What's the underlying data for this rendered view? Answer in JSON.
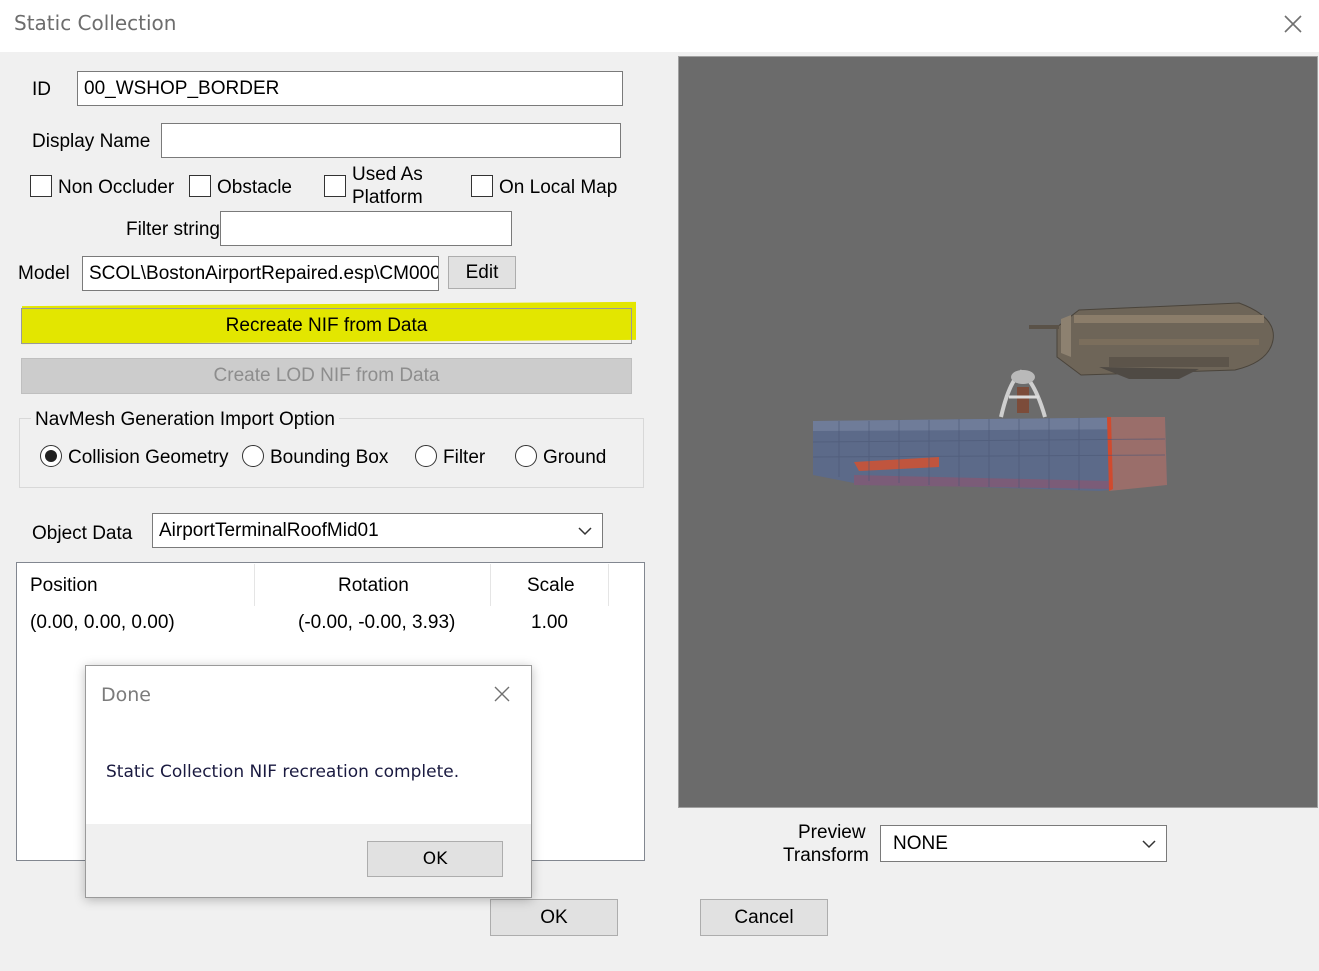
{
  "window": {
    "title": "Static Collection"
  },
  "form": {
    "id_label": "ID",
    "id_value": "00_WSHOP_BORDER",
    "display_name_label": "Display Name",
    "display_name_value": "",
    "checkboxes": {
      "non_occluder": "Non Occluder",
      "obstacle": "Obstacle",
      "used_as_platform_line1": "Used As",
      "used_as_platform_line2": "Platform",
      "on_local_map": "On Local Map"
    },
    "filter_label": "Filter string",
    "filter_value": "",
    "model_label": "Model",
    "model_value": "SCOL\\BostonAirportRepaired.esp\\CM000",
    "edit_button": "Edit",
    "recreate_button": "Recreate NIF from Data",
    "create_lod_button": "Create LOD NIF from Data",
    "navmesh": {
      "group_label": "NavMesh Generation Import Option",
      "options": [
        "Collision Geometry",
        "Bounding Box",
        "Filter",
        "Ground"
      ],
      "selected": "Collision Geometry"
    },
    "object_data_label": "Object Data",
    "object_data_value": "AirportTerminalRoofMid01",
    "table": {
      "columns": [
        "Position",
        "Rotation",
        "Scale"
      ],
      "rows": [
        {
          "position": "(0.00, 0.00, 0.00)",
          "rotation": "(-0.00, -0.00, 3.93)",
          "scale": "1.00"
        }
      ]
    },
    "preview_transform_label_line1": "Preview",
    "preview_transform_label_line2": "Transform",
    "preview_transform_value": "NONE",
    "ok_button": "OK",
    "cancel_button": "Cancel"
  },
  "dialog": {
    "title": "Done",
    "message": "Static Collection NIF recreation complete.",
    "ok_button": "OK"
  },
  "colors": {
    "highlight": "#e3e600",
    "preview_bg": "#6b6b6b",
    "window_bg": "#f0f0f0"
  }
}
